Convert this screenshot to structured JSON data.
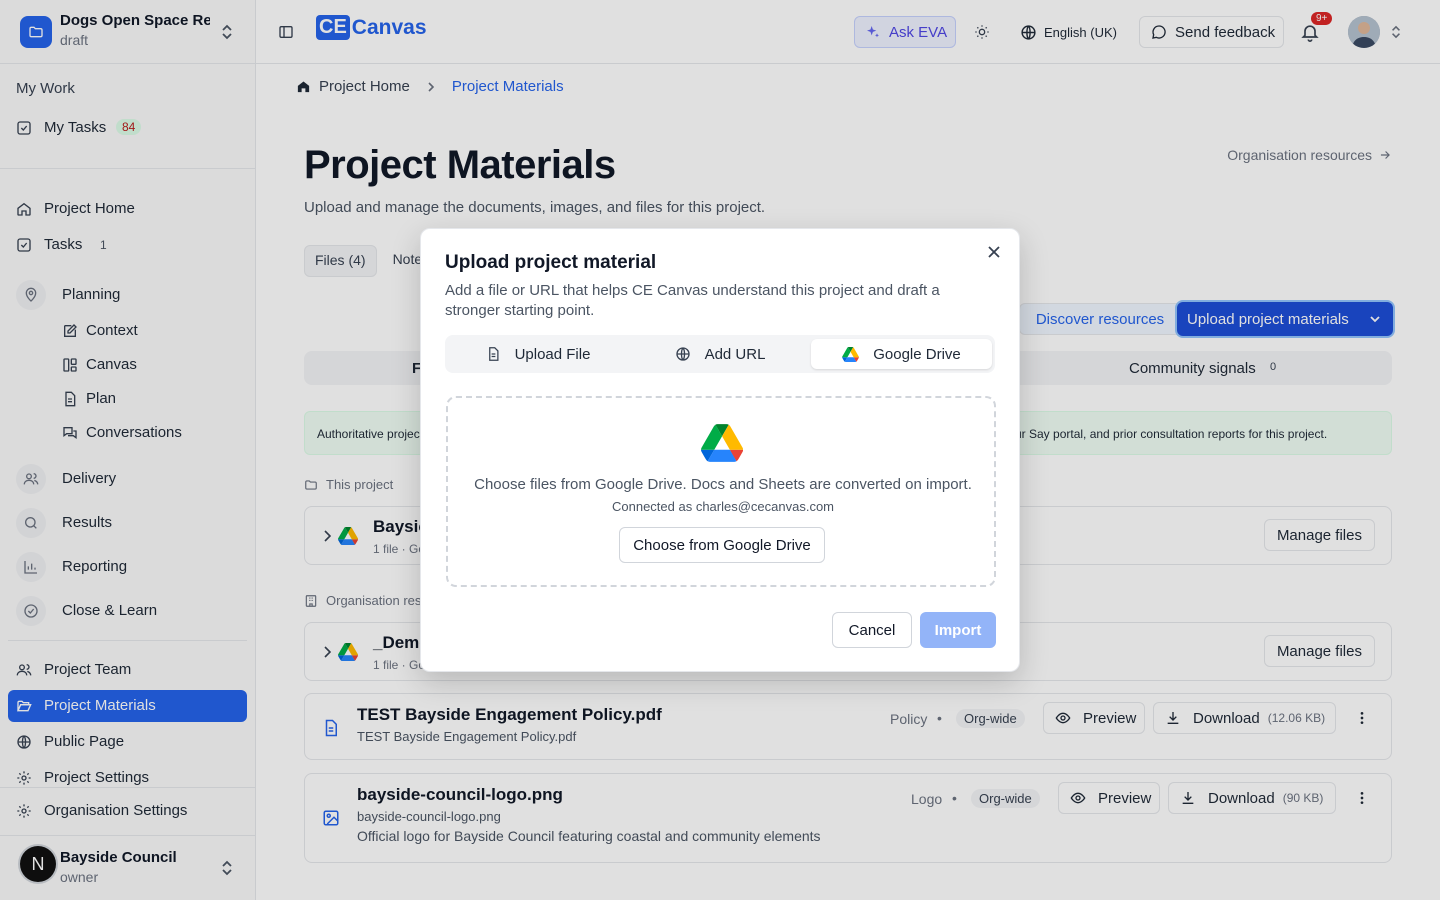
{
  "sidebar": {
    "project_name": "Dogs Open Space Re...",
    "project_status": "draft",
    "my_work_title": "My Work",
    "my_tasks": {
      "label": "My Tasks",
      "count": "84"
    },
    "project_home": "Project Home",
    "tasks": {
      "label": "Tasks",
      "count": "1"
    },
    "planning": "Planning",
    "planning_items": [
      "Context",
      "Canvas",
      "Plan",
      "Conversations"
    ],
    "delivery": "Delivery",
    "results": "Results",
    "reporting": "Reporting",
    "close_learn": "Close & Learn",
    "project_team": "Project Team",
    "project_materials": "Project Materials",
    "public_page": "Public Page",
    "project_settings": "Project Settings",
    "org_settings": "Organisation Settings",
    "org": {
      "initial": "N",
      "name": "Bayside Council",
      "role": "owner"
    }
  },
  "topbar": {
    "logo_box": "CE",
    "logo_text": "Canvas",
    "ask_eva": "Ask EVA",
    "language": "English (UK)",
    "send_feedback": "Send feedback",
    "notif_badge": "9+"
  },
  "main": {
    "breadcrumb": [
      "Project Home",
      "Project Materials"
    ],
    "title": "Project Materials",
    "subtitle": "Upload and manage the documents, images, and files for this project.",
    "org_resources_link": "Organisation resources",
    "tabs": [
      "Files (4)",
      "Notes"
    ],
    "discover_button": "Discover resources",
    "upload_button": "Upload project materials",
    "subtab_partial": "F",
    "community_signals": {
      "label": "Community signals",
      "count": "0"
    },
    "banner_left": "Authoritative projec",
    "banner_right": "ur Say portal, and prior consultation reports for this project.",
    "this_project_label": "This project",
    "org_resources_label": "Organisation reso",
    "drive_groups": [
      {
        "name": "Baysic",
        "meta": "1 file · Go",
        "manage": "Manage files"
      },
      {
        "name": "_Demo",
        "meta": "1 file · Go",
        "manage": "Manage files"
      }
    ],
    "files": [
      {
        "name": "TEST Bayside Engagement Policy.pdf",
        "filename": "TEST Bayside Engagement Policy.pdf",
        "category": "Policy",
        "scope": "Org-wide",
        "preview": "Preview",
        "download": "Download",
        "size": "(12.06 KB)",
        "description": ""
      },
      {
        "name": "bayside-council-logo.png",
        "filename": "bayside-council-logo.png",
        "category": "Logo",
        "scope": "Org-wide",
        "preview": "Preview",
        "download": "Download",
        "size": "(90 KB)",
        "description": "Official logo for Bayside Council featuring coastal and community elements"
      }
    ]
  },
  "dialog": {
    "title": "Upload project material",
    "description": "Add a file or URL that helps CE Canvas understand this project and draft a stronger starting point.",
    "tabs": [
      "Upload File",
      "Add URL",
      "Google Drive"
    ],
    "selected_tab": "Google Drive",
    "drive_text": "Choose files from Google Drive. Docs and Sheets are converted on import.",
    "connected_as": "Connected as charles@cecanvas.com",
    "choose_button": "Choose from Google Drive",
    "cancel": "Cancel",
    "import": "Import"
  },
  "colors": {
    "accent": "#2563eb",
    "badge_red": "#dc2626",
    "tasks_badge_bg": "#dcfce7"
  }
}
